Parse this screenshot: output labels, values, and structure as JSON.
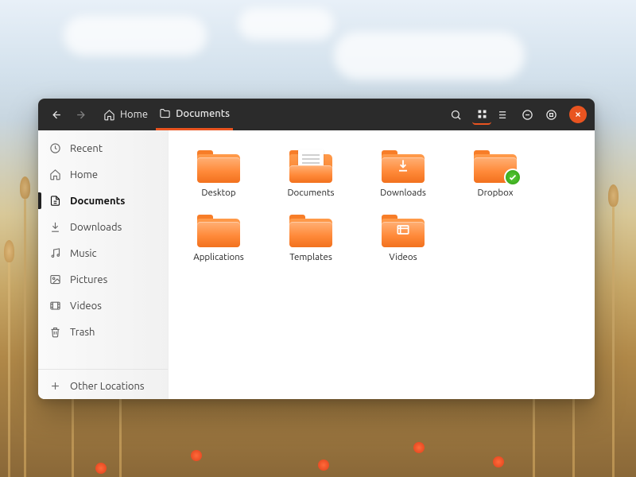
{
  "breadcrumb": [
    {
      "label": "Home",
      "active": false
    },
    {
      "label": "Documents",
      "active": true
    }
  ],
  "sidebar": {
    "items": [
      {
        "icon": "clock",
        "label": "Recent",
        "active": false
      },
      {
        "icon": "home",
        "label": "Home",
        "active": false
      },
      {
        "icon": "document",
        "label": "Documents",
        "active": true
      },
      {
        "icon": "download",
        "label": "Downloads",
        "active": false
      },
      {
        "icon": "music",
        "label": "Music",
        "active": false
      },
      {
        "icon": "picture",
        "label": "Pictures",
        "active": false
      },
      {
        "icon": "video",
        "label": "Videos",
        "active": false
      },
      {
        "icon": "trash",
        "label": "Trash",
        "active": false
      }
    ],
    "other_locations_label": "Other Locations"
  },
  "folders": [
    {
      "label": "Desktop",
      "overlay": null,
      "badge": null
    },
    {
      "label": "Documents",
      "overlay": "doc",
      "badge": null
    },
    {
      "label": "Downloads",
      "overlay": "download",
      "badge": null
    },
    {
      "label": "Dropbox",
      "overlay": null,
      "badge": "sync"
    },
    {
      "label": "Applications",
      "overlay": null,
      "badge": null
    },
    {
      "label": "Templates",
      "overlay": null,
      "badge": null
    },
    {
      "label": "Videos",
      "overlay": "video",
      "badge": null
    }
  ],
  "colors": {
    "accent": "#e95420"
  }
}
